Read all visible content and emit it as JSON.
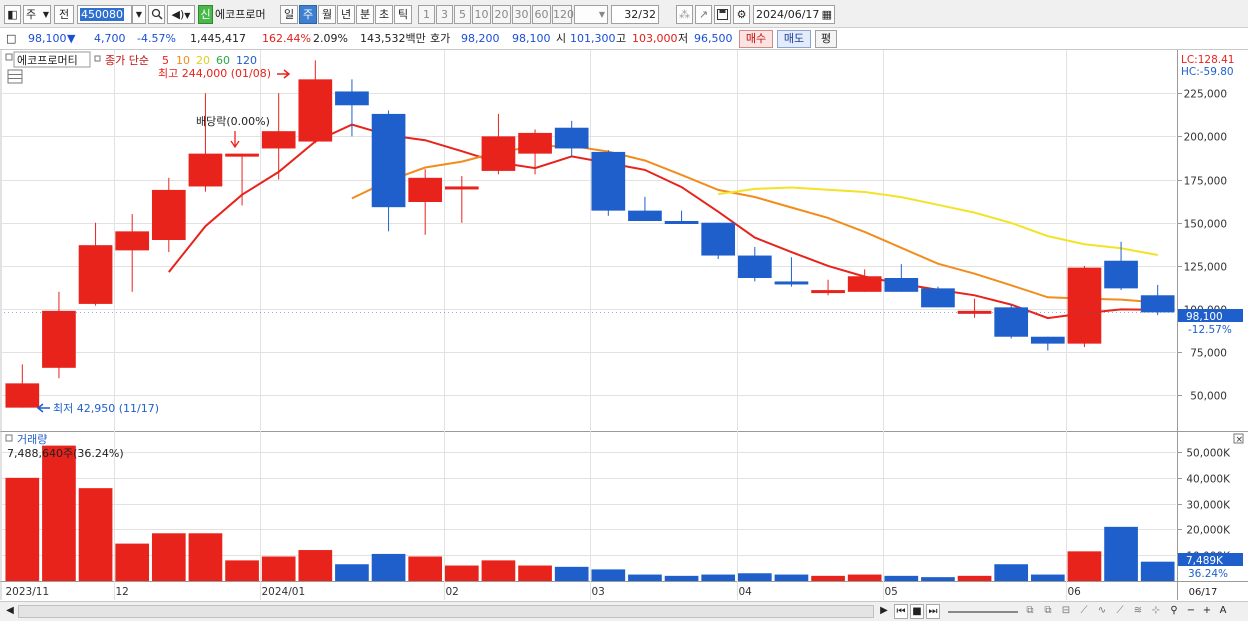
{
  "toolbar": {
    "type_label": "주",
    "prev_label": "전",
    "code": "450080",
    "new_badge": "신",
    "stock_name": "에코프로머",
    "periods": [
      "일",
      "주",
      "월",
      "년",
      "분",
      "초",
      "틱"
    ],
    "selected_period": "주",
    "intervals": [
      "1",
      "3",
      "5",
      "10",
      "20",
      "30",
      "60",
      "120"
    ],
    "count": "32",
    "count_total": "/32",
    "date": "2024/06/17"
  },
  "quote": {
    "price": "98,100",
    "change": "4,700",
    "change_pct": "-4.57%",
    "volume": "1,445,417",
    "volume_ratio": "162.44%",
    "turnover_pct": "2.09%",
    "amount": "143,532백만",
    "ask_label": "호가",
    "ask": "98,200",
    "bid": "98,100",
    "open_label": "시",
    "open": "101,300",
    "high_label": "고",
    "high": "103,000",
    "low_label": "저",
    "low": "96,500",
    "buy_label": "매수",
    "sell_label": "매도",
    "flat_label": "평"
  },
  "price_panel": {
    "legend_name": "에코프로머티",
    "legend_type": "종가 단순",
    "ma_periods": [
      "5",
      "10",
      "20",
      "60",
      "120"
    ],
    "lc": "LC:128.41",
    "hc": "HC:-59.80",
    "max_annotation": "최고 244,000 (01/08)",
    "min_annotation": "최저 42,950 (11/17)",
    "dividend_annotation": "배당락(0.00%)",
    "current_price_tag": "98,100",
    "current_pct_tag": "-12.57%"
  },
  "volume_panel": {
    "title": "거래량",
    "max_label": "7,488,640주(36.24%)",
    "current_tag": "7,489K",
    "current_pct_tag": "36.24%"
  },
  "scroll": {
    "end_label": "06/17"
  },
  "colors": {
    "up": "#e8231b",
    "down": "#1f5fcc",
    "ma5": "#e8231b",
    "ma10": "#f28c1c",
    "ma20": "#f3e327",
    "ma60": "#2aa84a",
    "ma120": "#1f5fcc"
  },
  "chart_data": {
    "type": "candlestick",
    "x_axis_labels": [
      "2023/11",
      "12",
      "2024/01",
      "02",
      "03",
      "04",
      "05",
      "06"
    ],
    "price_axis": {
      "ticks": [
        50000,
        75000,
        100000,
        125000,
        150000,
        175000,
        200000,
        225000
      ],
      "ylim": [
        30000,
        250000
      ]
    },
    "volume_axis": {
      "ticks": [
        10000,
        20000,
        30000,
        40000,
        50000
      ],
      "unit": "K",
      "ylim": [
        0,
        57000
      ]
    },
    "candles": [
      {
        "o": 42950,
        "h": 68000,
        "l": 42950,
        "c": 57000,
        "v": 40000
      },
      {
        "o": 66000,
        "h": 110000,
        "l": 60000,
        "c": 99000,
        "v": 52500
      },
      {
        "o": 103000,
        "h": 150000,
        "l": 102000,
        "c": 137000,
        "v": 36000
      },
      {
        "o": 134000,
        "h": 155000,
        "l": 110000,
        "c": 145000,
        "v": 14500
      },
      {
        "o": 140000,
        "h": 176000,
        "l": 133000,
        "c": 169000,
        "v": 18500
      },
      {
        "o": 171000,
        "h": 225000,
        "l": 168000,
        "c": 190000,
        "v": 18500
      },
      {
        "o": 190000,
        "h": 190000,
        "l": 160000,
        "c": 190000,
        "v": 8000
      },
      {
        "o": 193000,
        "h": 225000,
        "l": 175000,
        "c": 203000,
        "v": 9500
      },
      {
        "o": 197000,
        "h": 244000,
        "l": 196000,
        "c": 233000,
        "v": 12000
      },
      {
        "o": 226000,
        "h": 233000,
        "l": 200000,
        "c": 218000,
        "v": 6500
      },
      {
        "o": 213000,
        "h": 215000,
        "l": 145000,
        "c": 159000,
        "v": 10500
      },
      {
        "o": 162000,
        "h": 181000,
        "l": 143000,
        "c": 176000,
        "v": 9500
      },
      {
        "o": 171000,
        "h": 177000,
        "l": 150000,
        "c": 171000,
        "v": 6000
      },
      {
        "o": 180000,
        "h": 213000,
        "l": 178000,
        "c": 200000,
        "v": 8000
      },
      {
        "o": 190000,
        "h": 204000,
        "l": 178000,
        "c": 202000,
        "v": 6000
      },
      {
        "o": 205000,
        "h": 209000,
        "l": 188000,
        "c": 193000,
        "v": 5500
      },
      {
        "o": 191000,
        "h": 192000,
        "l": 154000,
        "c": 157000,
        "v": 4500
      },
      {
        "o": 157000,
        "h": 165000,
        "l": 151000,
        "c": 151000,
        "v": 2500
      },
      {
        "o": 151000,
        "h": 157000,
        "l": 150000,
        "c": 150000,
        "v": 2000
      },
      {
        "o": 150000,
        "h": 150000,
        "l": 129000,
        "c": 131000,
        "v": 2500
      },
      {
        "o": 131000,
        "h": 136000,
        "l": 116000,
        "c": 118000,
        "v": 3000
      },
      {
        "o": 116000,
        "h": 130000,
        "l": 113000,
        "c": 115000,
        "v": 2500
      },
      {
        "o": 110000,
        "h": 117000,
        "l": 108000,
        "c": 111000,
        "v": 2000
      },
      {
        "o": 110000,
        "h": 123000,
        "l": 110000,
        "c": 119000,
        "v": 2500
      },
      {
        "o": 118000,
        "h": 126000,
        "l": 110000,
        "c": 110000,
        "v": 2000
      },
      {
        "o": 112000,
        "h": 113000,
        "l": 101000,
        "c": 101000,
        "v": 1500
      },
      {
        "o": 99000,
        "h": 106000,
        "l": 95000,
        "c": 99000,
        "v": 2000
      },
      {
        "o": 101000,
        "h": 103000,
        "l": 83000,
        "c": 84000,
        "v": 6500
      },
      {
        "o": 84000,
        "h": 84000,
        "l": 76000,
        "c": 80000,
        "v": 2500
      },
      {
        "o": 80000,
        "h": 125000,
        "l": 78000,
        "c": 124000,
        "v": 11500
      },
      {
        "o": 128000,
        "h": 139000,
        "l": 111000,
        "c": 112000,
        "v": 21000
      },
      {
        "o": 108000,
        "h": 114000,
        "l": 96500,
        "c": 98100,
        "v": 7489
      }
    ],
    "annotations": [
      "최고 244,000 (01/08)",
      "최저 42,950 (11/17)",
      "배당락(0.00%)"
    ]
  }
}
